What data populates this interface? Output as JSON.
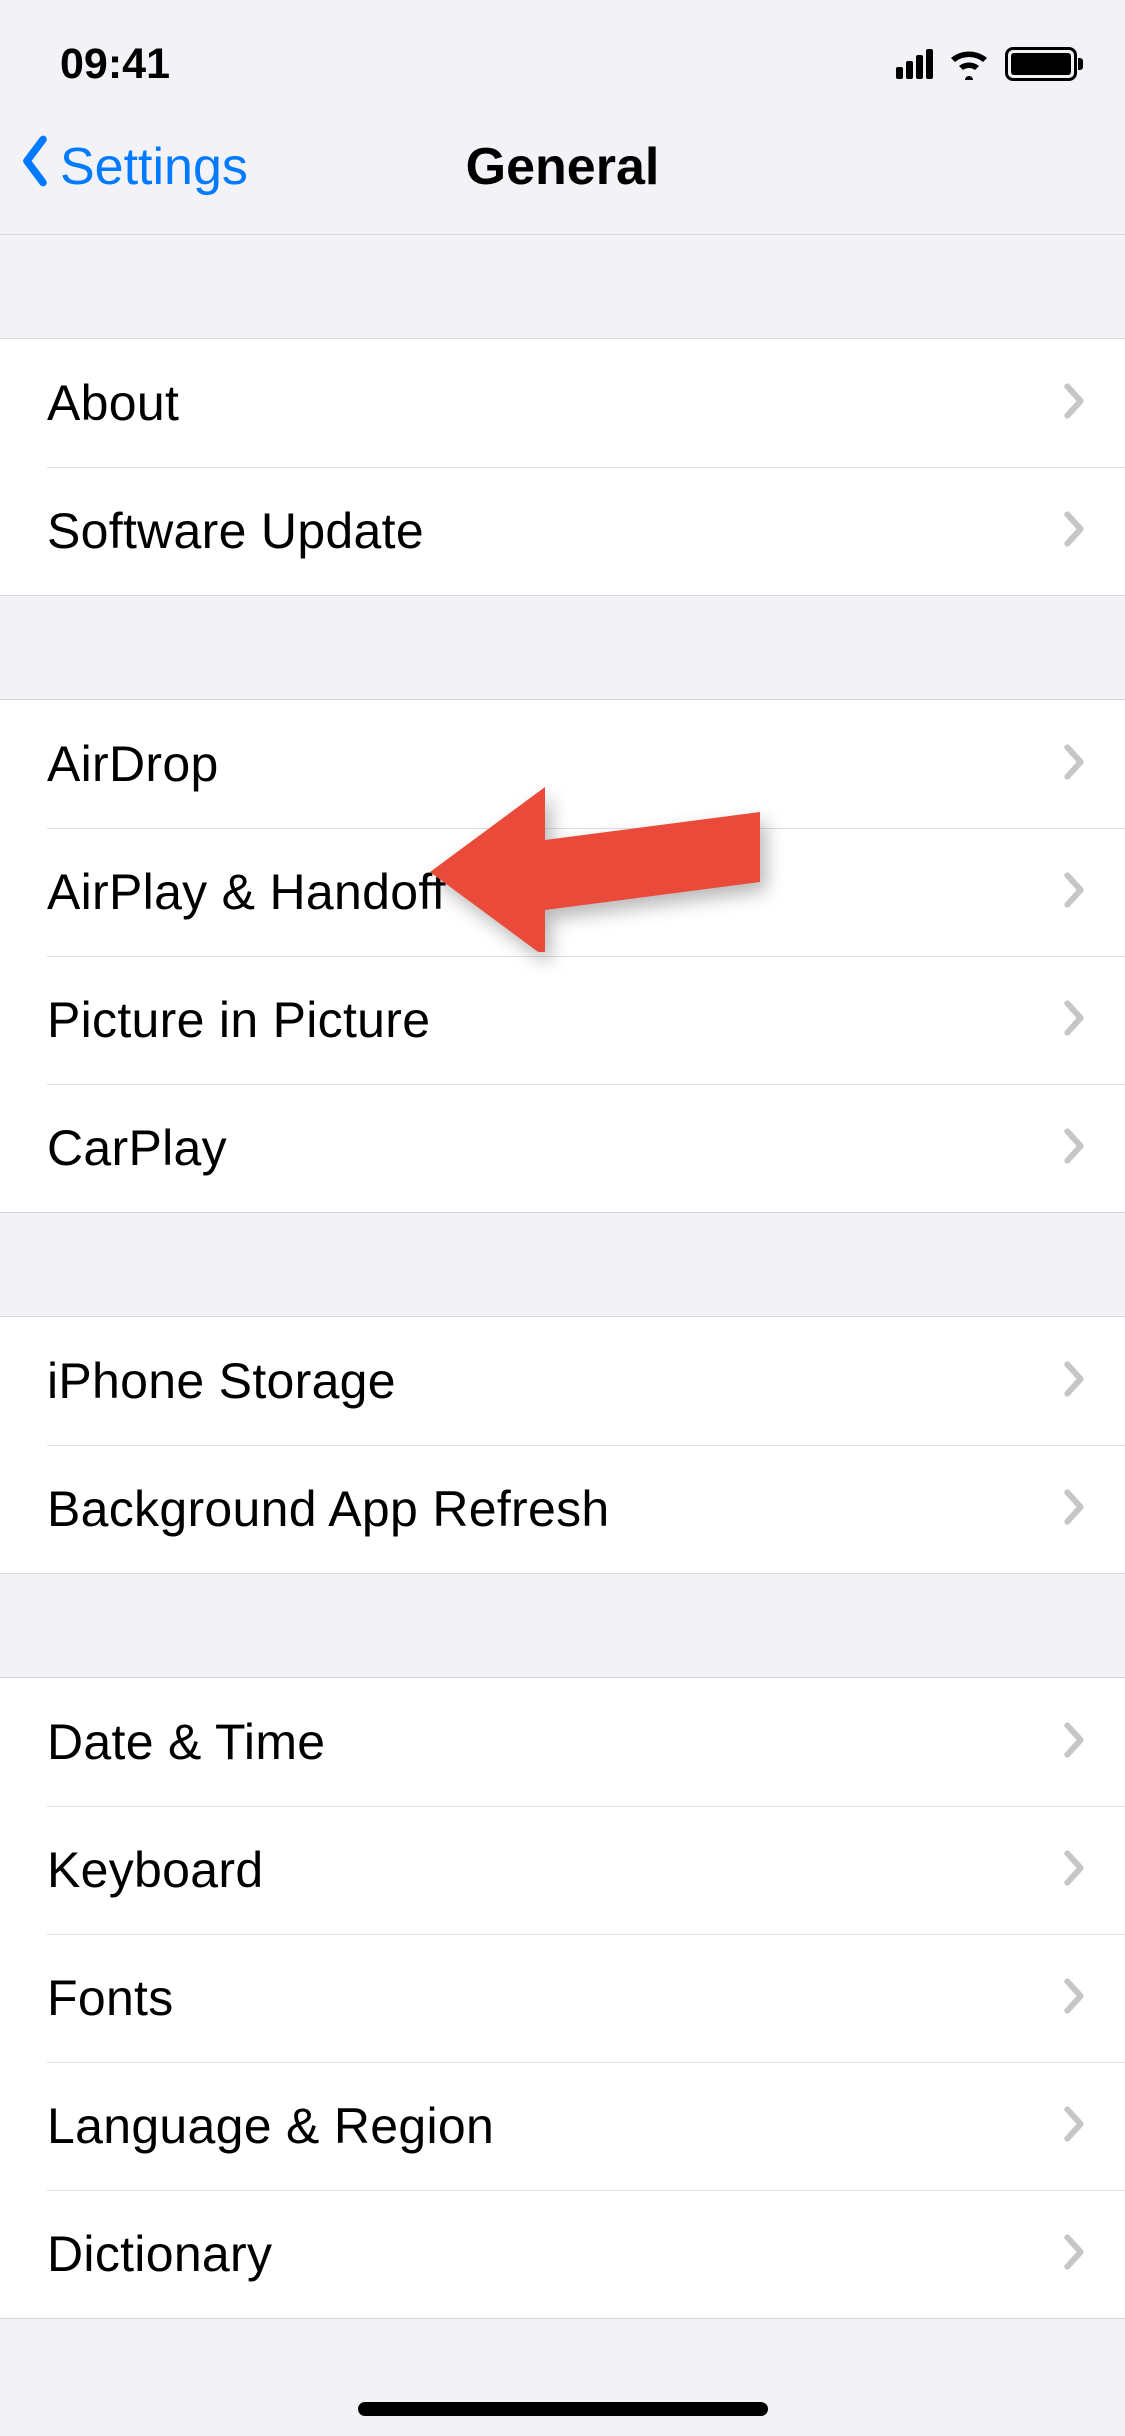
{
  "statusbar": {
    "time": "09:41"
  },
  "nav": {
    "back_label": "Settings",
    "title": "General"
  },
  "groups": [
    {
      "rows": [
        {
          "id": "about",
          "label": "About"
        },
        {
          "id": "software-update",
          "label": "Software Update"
        }
      ]
    },
    {
      "rows": [
        {
          "id": "airdrop",
          "label": "AirDrop"
        },
        {
          "id": "airplay-handoff",
          "label": "AirPlay & Handoff"
        },
        {
          "id": "picture-in-picture",
          "label": "Picture in Picture"
        },
        {
          "id": "carplay",
          "label": "CarPlay"
        }
      ]
    },
    {
      "rows": [
        {
          "id": "iphone-storage",
          "label": "iPhone Storage"
        },
        {
          "id": "background-app-refresh",
          "label": "Background App Refresh"
        }
      ]
    },
    {
      "rows": [
        {
          "id": "date-time",
          "label": "Date & Time"
        },
        {
          "id": "keyboard",
          "label": "Keyboard"
        },
        {
          "id": "fonts",
          "label": "Fonts"
        },
        {
          "id": "language-region",
          "label": "Language & Region"
        },
        {
          "id": "dictionary",
          "label": "Dictionary"
        }
      ]
    }
  ],
  "annotation": {
    "arrow_color": "#ea4a3a",
    "target_row": "airplay-handoff"
  }
}
